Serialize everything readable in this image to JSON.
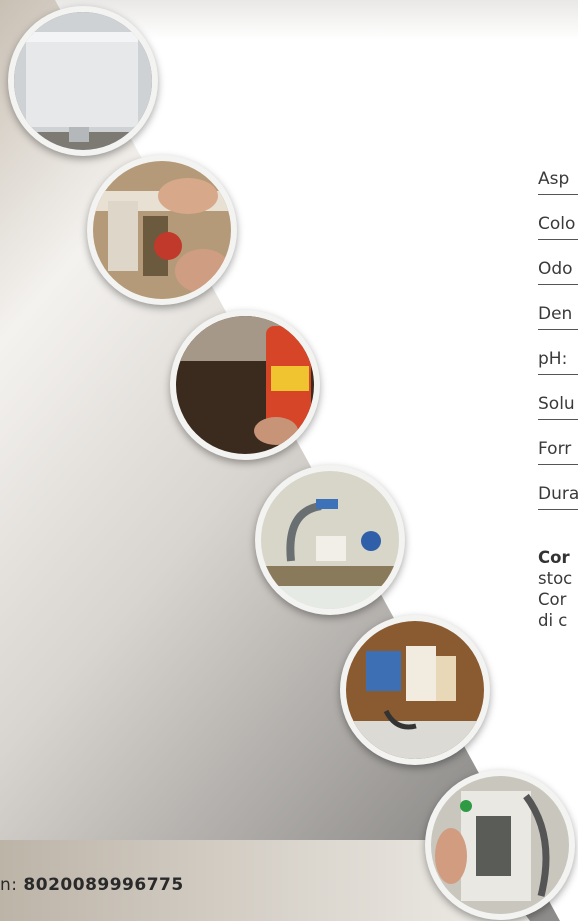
{
  "specs": {
    "rows": [
      "Asp",
      "Colo",
      "Odo",
      "Den",
      "pH:",
      "Solu",
      "Forr",
      "Dura"
    ]
  },
  "description": {
    "line1": "Cor",
    "line2": "stoc",
    "line3": "Cor",
    "line4": "di c"
  },
  "barcode": {
    "label": "n:",
    "value": "8020089996775"
  },
  "photos": [
    "cistern-cover-photo",
    "valve-hand-photo",
    "spray-can-photo",
    "hose-connection-photo",
    "float-valve-photo",
    "flush-mechanism-photo"
  ]
}
